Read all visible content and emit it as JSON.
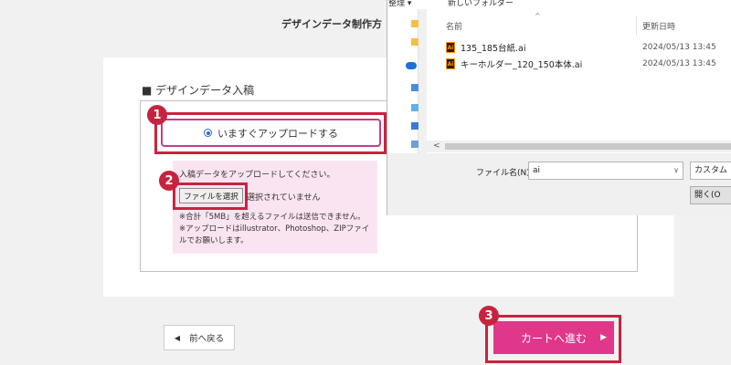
{
  "page": {
    "title": "デザインデータ制作方",
    "section_title": "■ デザインデータ入稿"
  },
  "upload": {
    "radio_label": "いますぐアップロードする",
    "instruction": "入稿データをアップロードしてください。",
    "choose_file_label": "ファイルを選択",
    "no_file_text": "選択されていません",
    "note_1": "※合計「5MB」を超えるファイルは送信できません。",
    "note_2": "※アップロードはillustrator、Photoshop、ZIPファイ",
    "note_3": "ルでお願いします。"
  },
  "nav": {
    "prev_arrow": "◀",
    "prev_label": "前へ戻る",
    "cart_label": "カートへ進む",
    "cart_arrow": "▶"
  },
  "badges": [
    "1",
    "2",
    "3"
  ],
  "colors": {
    "highlight": "#c8233e",
    "cart_button": "#e1378b",
    "pink_panel": "#fbe4f1"
  },
  "dialog": {
    "toolbar": {
      "organize": "整理 ▾",
      "new_folder": "新しいフォルダー"
    },
    "columns": {
      "name": "名前",
      "modified": "更新日時"
    },
    "files": [
      {
        "name": "135_185台紙.ai",
        "date": "2024/05/13 13:45",
        "icon": "illustrator-file-icon"
      },
      {
        "name": "キーホルダー_120_150本体.ai",
        "date": "2024/05/13 13:45",
        "icon": "illustrator-file-icon"
      }
    ],
    "filename_label": "ファイル名(N):",
    "filename_value": "ai",
    "filter_label": "カスタム フ",
    "open_label": "開く(O"
  }
}
